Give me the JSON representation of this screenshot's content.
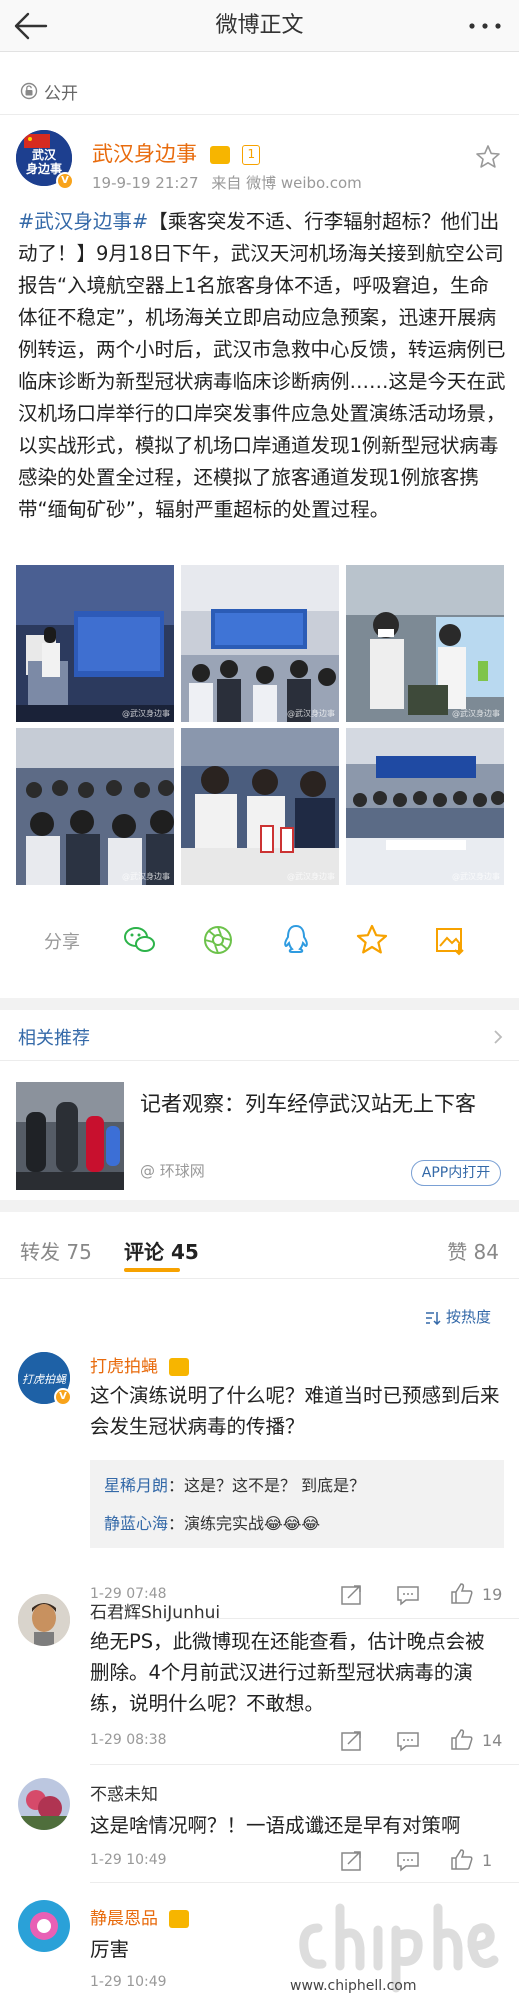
{
  "nav": {
    "title": "微博正文"
  },
  "visibility": {
    "label": "公开"
  },
  "author": {
    "avatar_text_line1": "武汉",
    "avatar_text_line2": "身边事",
    "name": "武汉身边事",
    "vip_label": "1",
    "time": "19-9-19 21:27",
    "source": "来自 微博 weibo.com"
  },
  "post": {
    "hashtag": "#武汉身边事#",
    "body": "【乘客突发不适、行李辐射超标？他们出动了！】9月18日下午，武汉天河机场海关接到航空公司报告“入境航空器上1名旅客身体不适，呼吸窘迫，生命体征不稳定”，机场海关立即启动应急预案，迅速开展病例转运，两个小时后，武汉市急救中心反馈，转运病例已临床诊断为新型冠状病毒临床诊断病例……这是今天在武汉机场口岸举行的口岸突发事件应急处置演练活动场景，以实战形式，模拟了机场口岸通道发现1例新型冠状病毒感染的处置全过程，还模拟了旅客通道发现1例旅客携带“缅甸矿砂”，辐射严重超标的处置过程。",
    "photos": [
      {
        "desc": "lectern-stage",
        "watermark": "@武汉身边事"
      },
      {
        "desc": "meeting-hall",
        "watermark": "@武汉身边事"
      },
      {
        "desc": "officers-masks",
        "watermark": "@武汉身边事"
      },
      {
        "desc": "audience",
        "watermark": "@武汉身边事"
      },
      {
        "desc": "officials-table",
        "watermark": "@武汉身边事"
      },
      {
        "desc": "hall-wide",
        "watermark": "@武汉身边事"
      }
    ],
    "stage_sign": "武汉海关2019年口岸公共卫生应急处置演练"
  },
  "share": {
    "label": "分享",
    "icons": [
      "wechat-icon",
      "moments-icon",
      "qq-icon",
      "favorite-star-icon",
      "save-icon"
    ]
  },
  "recommend": {
    "title": "相关推荐",
    "card_title": "记者观察：列车经停武汉站无上下客",
    "source": "@ 环球网",
    "app_open": "APP内打开"
  },
  "tabs": {
    "repost_label": "转发",
    "repost_count": "75",
    "comment_label": "评论",
    "comment_count": "45",
    "like_label": "赞",
    "like_count": "84"
  },
  "sort": {
    "label": "按热度"
  },
  "comments": [
    {
      "name": "打虎拍蝇",
      "avatar_text": "打虎拍蝇",
      "text": "这个演练说明了什么呢？难道当时已预感到后来会发生冠状病毒的传播？",
      "time": "1-29 07:48",
      "likes": "19",
      "replies": [
        {
          "name": "星稀月朗",
          "text": "：这是？这不是？ 到底是？"
        },
        {
          "name": "静蓝心海",
          "text": "：演练完实战😂😂😂"
        }
      ]
    },
    {
      "name": "石君辉ShiJunhui",
      "text": "绝无PS，此微博现在还能查看，估计晚点会被删除。4个月前武汉进行过新型冠状病毒的演练，说明什么呢？不敢想。",
      "time": "1-29 08:38",
      "likes": "14"
    },
    {
      "name": "不惑未知",
      "text": "这是啥情况啊？！一语成谶还是早有对策啊",
      "time": "1-29 10:49",
      "likes": "1"
    },
    {
      "name": "静晨恩品",
      "text": "厉害",
      "time": "1-29 10:49"
    }
  ],
  "watermark": {
    "url": "www.chiphell.com"
  },
  "colors": {
    "link": "#3469a8",
    "author": "#e86b0d",
    "accent": "#f7a200"
  }
}
